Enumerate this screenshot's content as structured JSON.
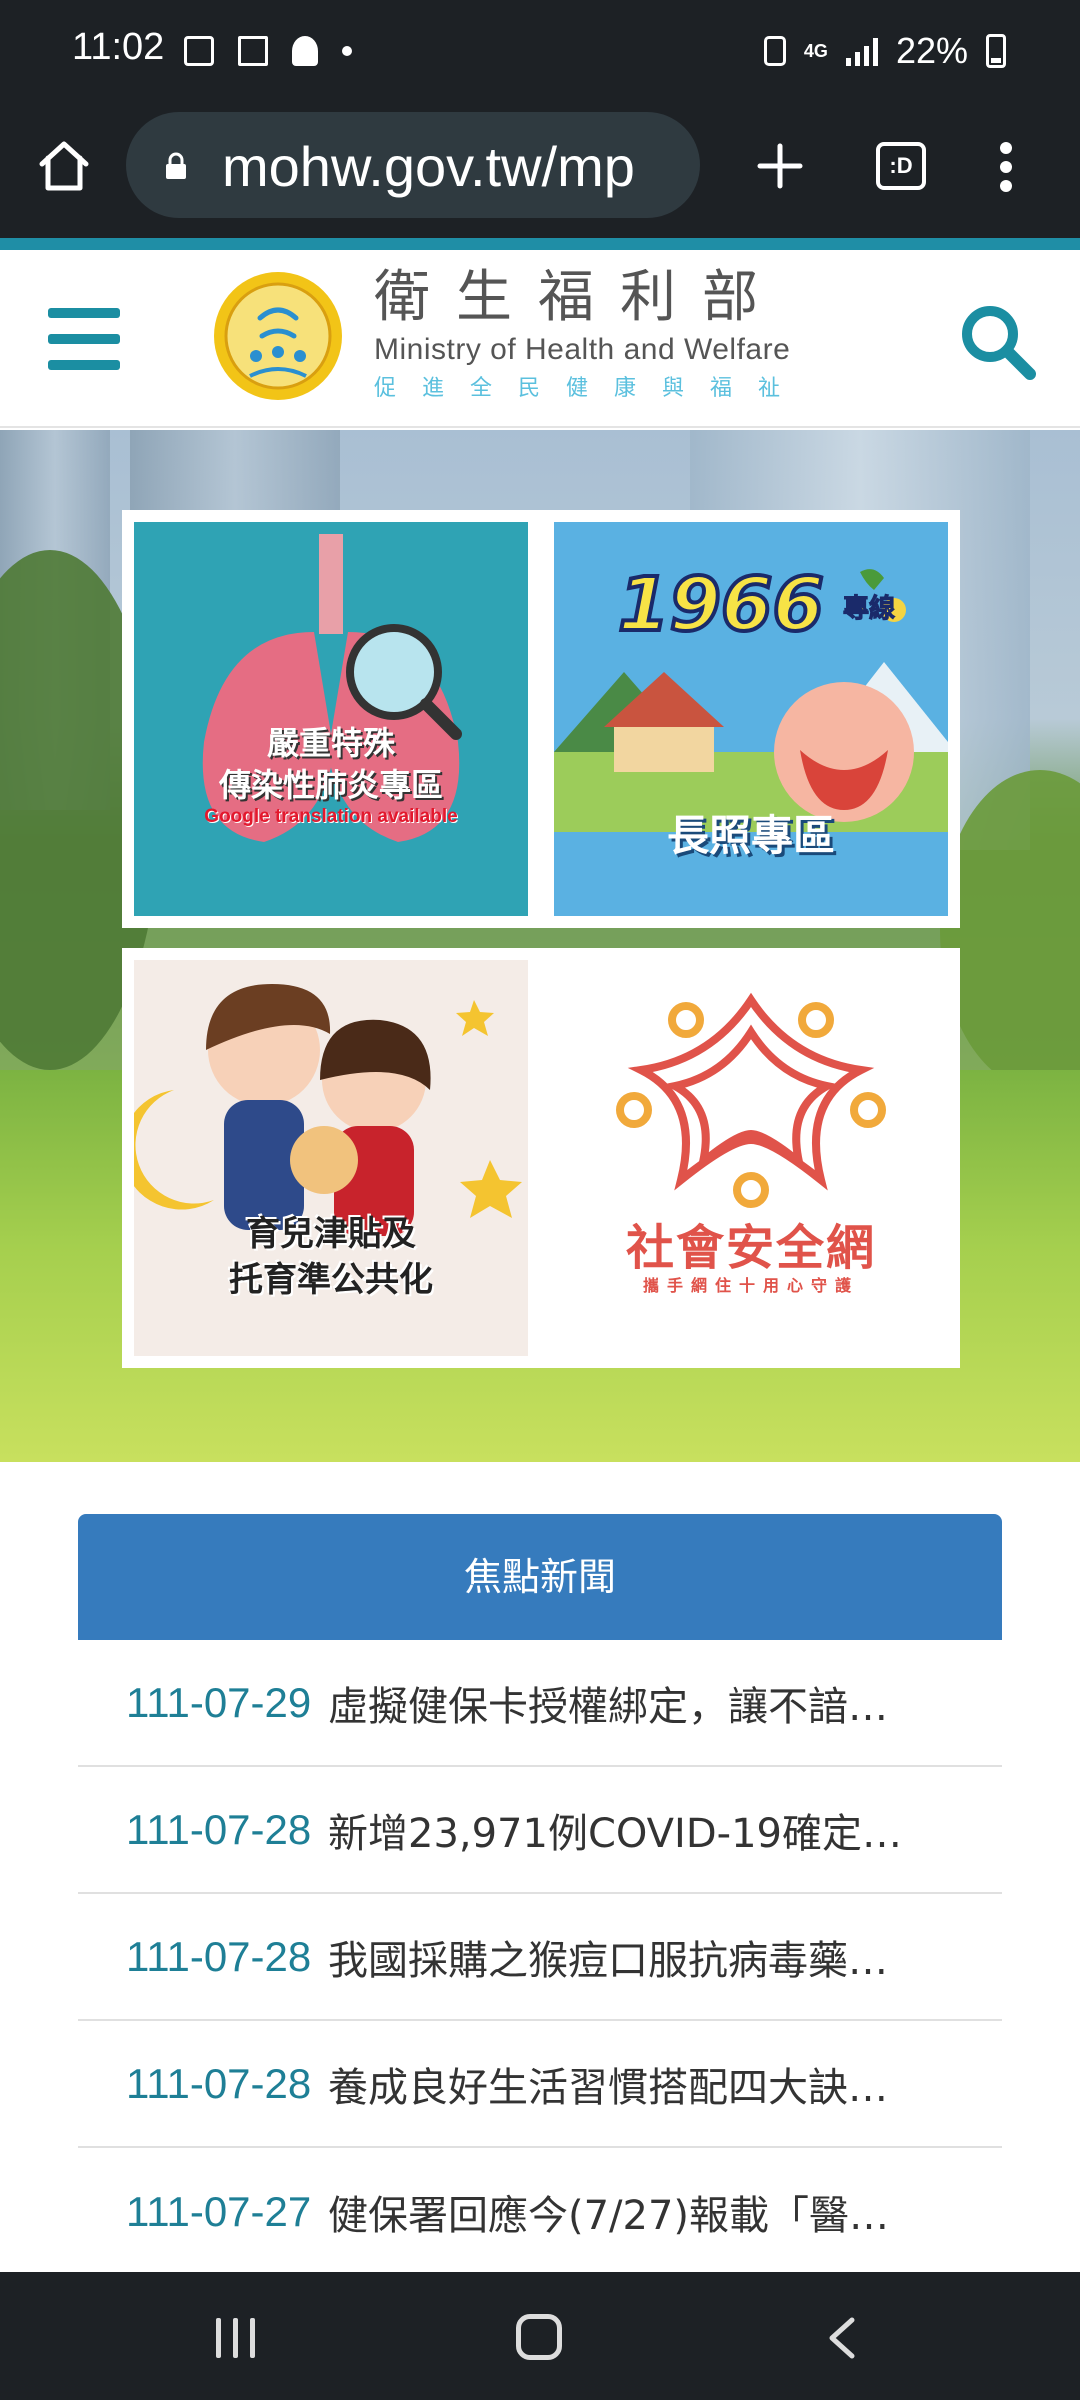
{
  "status_bar": {
    "time": "11:02",
    "network": "4G",
    "battery": "22%"
  },
  "browser": {
    "url": "mohw.gov.tw/mp",
    "tabs_label": ":D"
  },
  "header": {
    "org_name_cn": "衛生福利部",
    "org_name_en": "Ministry of Health and Welfare",
    "slogan": "促進全民健康與福祉"
  },
  "banners": [
    {
      "label_line1": "嚴重特殊",
      "label_line2": "傳染性肺炎專區",
      "note": "Google translation available"
    },
    {
      "hotline": "1966",
      "hotline_suffix": "專線",
      "label": "長照專區"
    },
    {
      "label_line1": "育兒津貼及",
      "label_line2": "托育準公共化"
    },
    {
      "label": "社會安全網",
      "tagline": "攜手網住十用心守護"
    }
  ],
  "news": {
    "heading": "焦點新聞",
    "items": [
      {
        "date": "111-07-29",
        "title": "虛擬健保卡授權綁定，讓不諳…"
      },
      {
        "date": "111-07-28",
        "title": "新增23,971例COVID-19確定…"
      },
      {
        "date": "111-07-28",
        "title": "我國採購之猴痘口服抗病毒藥…"
      },
      {
        "date": "111-07-28",
        "title": "養成良好生活習慣搭配四大訣…"
      },
      {
        "date": "111-07-27",
        "title": "健保署回應今(7/27)報載「醫…"
      }
    ]
  },
  "colors": {
    "brand_teal": "#1b8ea2",
    "news_blue": "#367bbd",
    "date_teal": "#1e7f96",
    "safety_net_red": "#e0534a"
  }
}
